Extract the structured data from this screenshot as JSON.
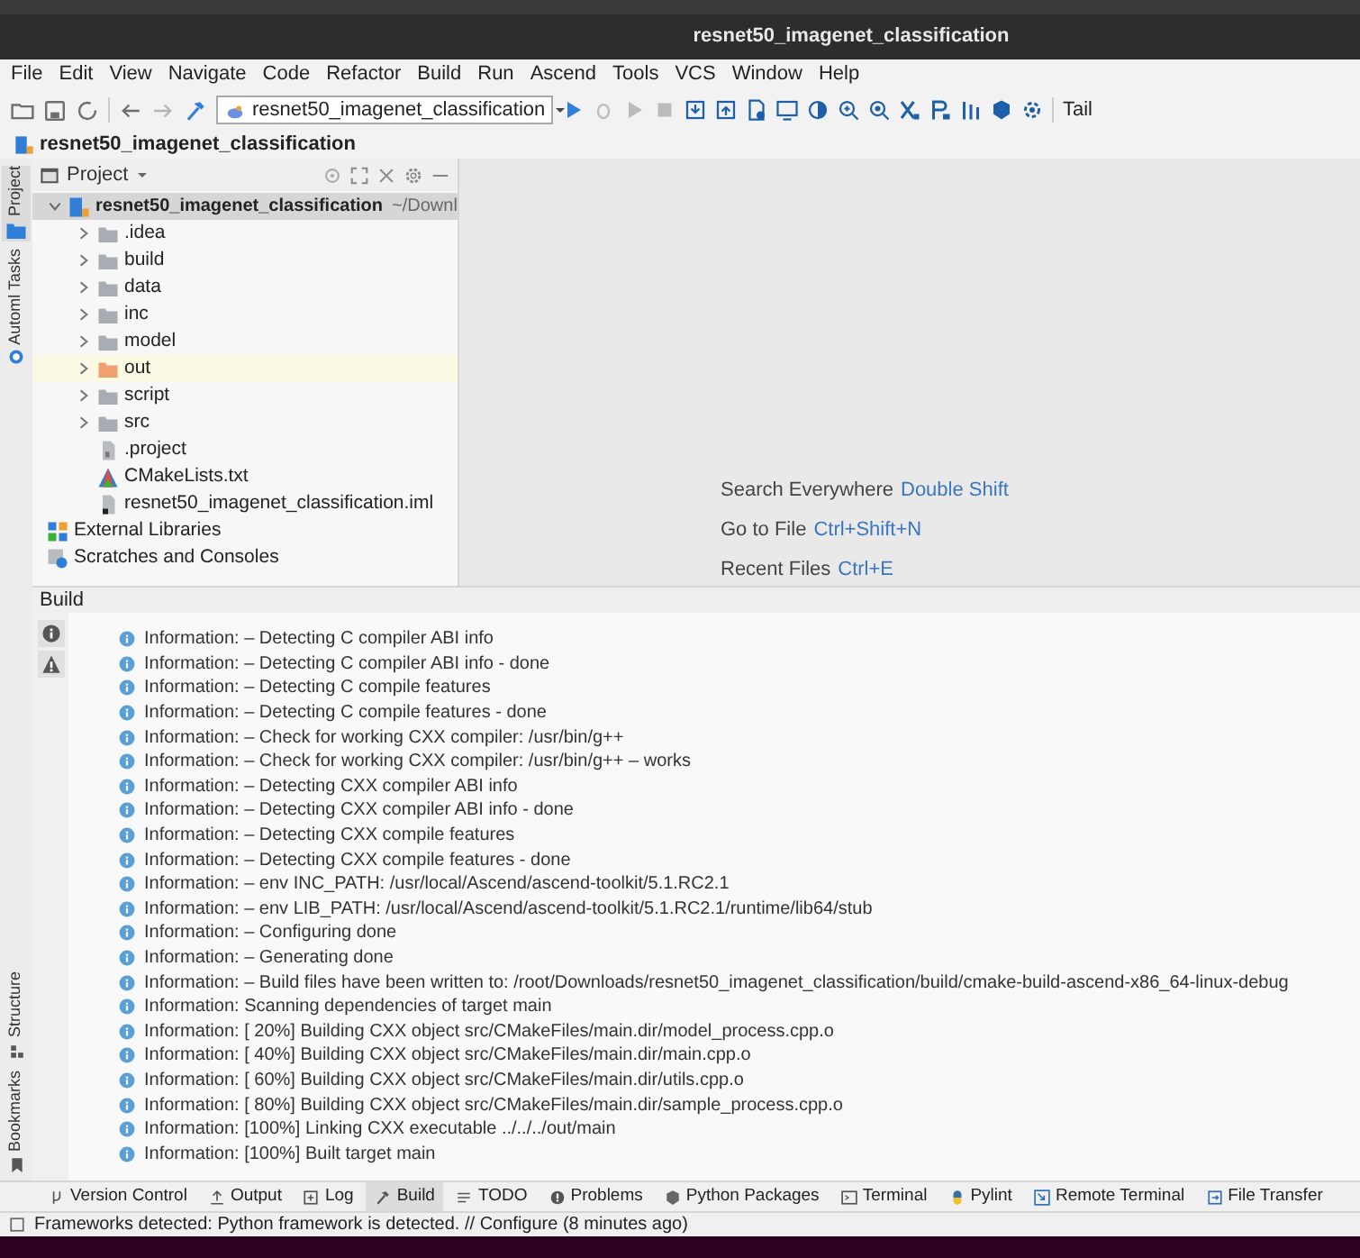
{
  "window": {
    "title": "resnet50_imagenet_classification"
  },
  "menu": [
    "File",
    "Edit",
    "View",
    "Navigate",
    "Code",
    "Refactor",
    "Build",
    "Run",
    "Ascend",
    "Tools",
    "VCS",
    "Window",
    "Help"
  ],
  "toolbar": {
    "run_configuration": "resnet50_imagenet_classification",
    "tail": "Tail"
  },
  "breadcrumb": "resnet50_imagenet_classification",
  "left_tool_tabs": [
    {
      "label": "Project",
      "selected": true
    },
    {
      "label": "Automl Tasks",
      "selected": false
    }
  ],
  "left_bottom_tool_tabs": [
    {
      "label": "Structure",
      "selected": false
    },
    {
      "label": "Bookmarks",
      "selected": false
    }
  ],
  "project_panel": {
    "title": "Project",
    "tree": [
      {
        "name": "resnet50_imagenet_classification",
        "path": "~/Downl",
        "kind": "project",
        "expanded": true,
        "selected": false,
        "children": [
          {
            "name": ".idea",
            "kind": "folder",
            "expanded": false,
            "selected": false
          },
          {
            "name": "build",
            "kind": "folder",
            "expanded": false,
            "selected": false
          },
          {
            "name": "data",
            "kind": "folder",
            "expanded": false,
            "selected": false
          },
          {
            "name": "inc",
            "kind": "folder",
            "expanded": false,
            "selected": false
          },
          {
            "name": "model",
            "kind": "folder",
            "expanded": false,
            "selected": false
          },
          {
            "name": "out",
            "kind": "excluded_folder",
            "expanded": false,
            "selected": true
          },
          {
            "name": "script",
            "kind": "folder",
            "expanded": false,
            "selected": false
          },
          {
            "name": "src",
            "kind": "folder",
            "expanded": false,
            "selected": false
          },
          {
            "name": ".project",
            "kind": "file",
            "selected": false
          },
          {
            "name": "CMakeLists.txt",
            "kind": "cmake",
            "selected": false
          },
          {
            "name": "resnet50_imagenet_classification.iml",
            "kind": "module_file",
            "selected": false
          }
        ]
      },
      {
        "name": "External Libraries",
        "kind": "libraries",
        "selected": false
      },
      {
        "name": "Scratches and Consoles",
        "kind": "scratches",
        "selected": false
      }
    ]
  },
  "editor_hints": [
    {
      "action": "Search Everywhere",
      "shortcut": "Double Shift"
    },
    {
      "action": "Go to File",
      "shortcut": "Ctrl+Shift+N"
    },
    {
      "action": "Recent Files",
      "shortcut": "Ctrl+E"
    }
  ],
  "build_panel": {
    "title": "Build",
    "messages": [
      "Information: – Detecting C compiler ABI info",
      "Information: – Detecting C compiler ABI info - done",
      "Information: – Detecting C compile features",
      "Information: – Detecting C compile features - done",
      "Information: – Check for working CXX compiler: /usr/bin/g++",
      "Information: – Check for working CXX compiler: /usr/bin/g++ – works",
      "Information: – Detecting CXX compiler ABI info",
      "Information: – Detecting CXX compiler ABI info - done",
      "Information: – Detecting CXX compile features",
      "Information: – Detecting CXX compile features - done",
      "Information: – env INC_PATH: /usr/local/Ascend/ascend-toolkit/5.1.RC2.1",
      "Information: – env LIB_PATH: /usr/local/Ascend/ascend-toolkit/5.1.RC2.1/runtime/lib64/stub",
      "Information: – Configuring done",
      "Information: – Generating done",
      "Information: – Build files have been written to: /root/Downloads/resnet50_imagenet_classification/build/cmake-build-ascend-x86_64-linux-debug",
      "Information: Scanning dependencies of target main",
      "Information: [ 20%] Building CXX object src/CMakeFiles/main.dir/model_process.cpp.o",
      "Information: [ 40%] Building CXX object src/CMakeFiles/main.dir/main.cpp.o",
      "Information: [ 60%] Building CXX object src/CMakeFiles/main.dir/utils.cpp.o",
      "Information: [ 80%] Building CXX object src/CMakeFiles/main.dir/sample_process.cpp.o",
      "Information: [100%] Linking CXX executable ../../../out/main",
      "Information: [100%] Built target main"
    ]
  },
  "bottom_tool_tabs": [
    {
      "label": "Version Control",
      "selected": false
    },
    {
      "label": "Output",
      "selected": false
    },
    {
      "label": "Log",
      "selected": false
    },
    {
      "label": "Build",
      "selected": true
    },
    {
      "label": "TODO",
      "selected": false
    },
    {
      "label": "Problems",
      "selected": false
    },
    {
      "label": "Python Packages",
      "selected": false
    },
    {
      "label": "Terminal",
      "selected": false
    },
    {
      "label": "Pylint",
      "selected": false
    },
    {
      "label": "Remote Terminal",
      "selected": false
    },
    {
      "label": "File Transfer",
      "selected": false
    }
  ],
  "status_bar": {
    "message": "Frameworks detected: Python framework is detected. // Configure (8 minutes ago)"
  }
}
